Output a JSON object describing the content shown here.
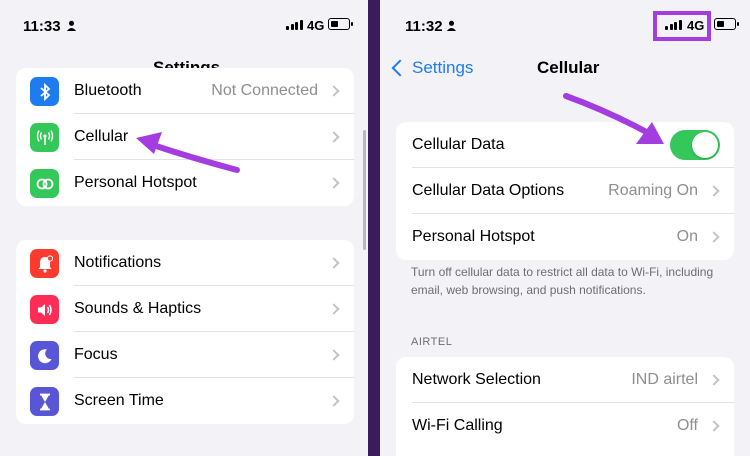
{
  "left": {
    "status": {
      "time": "11:33",
      "network": "4G"
    },
    "nav_title": "Settings",
    "group1": [
      {
        "label": "Bluetooth",
        "value": "Not Connected",
        "icon": "bluetooth-icon",
        "color": "#1e7cf0"
      },
      {
        "label": "Cellular",
        "value": "",
        "icon": "antenna-icon",
        "color": "#34c759"
      },
      {
        "label": "Personal Hotspot",
        "value": "",
        "icon": "hotspot-icon",
        "color": "#34c759"
      }
    ],
    "group2": [
      {
        "label": "Notifications",
        "icon": "bell-icon",
        "color": "#ff3b30"
      },
      {
        "label": "Sounds & Haptics",
        "icon": "speaker-icon",
        "color": "#ff2d55"
      },
      {
        "label": "Focus",
        "icon": "moon-icon",
        "color": "#5856d6"
      },
      {
        "label": "Screen Time",
        "icon": "hourglass-icon",
        "color": "#5856d6"
      }
    ]
  },
  "right": {
    "status": {
      "time": "11:32",
      "network": "4G"
    },
    "back_label": "Settings",
    "nav_title": "Cellular",
    "group1": [
      {
        "label": "Cellular Data",
        "toggle": "on"
      },
      {
        "label": "Cellular Data Options",
        "value": "Roaming On"
      },
      {
        "label": "Personal Hotspot",
        "value": "On"
      }
    ],
    "footnote": "Turn off cellular data to restrict all data to Wi-Fi, including email, web browsing, and push notifications.",
    "section_header": "AIRTEL",
    "group2": [
      {
        "label": "Network Selection",
        "value": "IND airtel"
      },
      {
        "label": "Wi-Fi Calling",
        "value": "Off"
      }
    ]
  },
  "colors": {
    "accent": "#1e7cf0",
    "toggle_on": "#34c759",
    "annotation": "#a33de0",
    "background": "#7b3fc4"
  }
}
